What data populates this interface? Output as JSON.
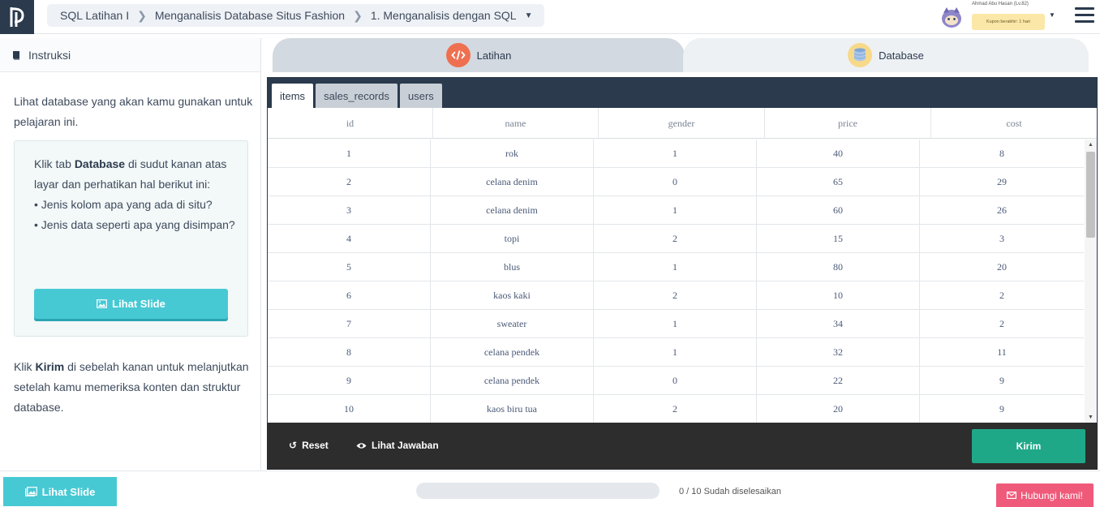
{
  "header": {
    "breadcrumb": [
      "SQL Latihan I",
      "Menganalisis Database Situs Fashion",
      "1. Menganalisis dengan SQL"
    ],
    "user_name": "Ahmad Abu Hasan (Lv.82)",
    "coupon_text": "Kupon berakhir: 1 hari"
  },
  "instructions": {
    "heading": "Instruksi",
    "intro": "Lihat database yang akan kamu gunakan untuk pelajaran ini.",
    "hint_prefix": "Klik tab ",
    "hint_bold": "Database",
    "hint_suffix": " di sudut kanan atas layar dan perhatikan hal berikut ini:",
    "bullet1": "• Jenis kolom apa yang ada di situ?",
    "bullet2": "• Jenis data seperti apa yang disimpan?",
    "slide_button": "Lihat Slide",
    "outro_prefix": "Klik ",
    "outro_bold": "Kirim",
    "outro_suffix": " di sebelah kanan untuk melanjutkan setelah kamu memeriksa konten dan struktur database."
  },
  "main_tabs": {
    "latihan": "Latihan",
    "database": "Database"
  },
  "table_tabs": [
    "items",
    "sales_records",
    "users"
  ],
  "table": {
    "columns": [
      "id",
      "name",
      "gender",
      "price",
      "cost"
    ],
    "rows": [
      [
        "1",
        "rok",
        "1",
        "40",
        "8"
      ],
      [
        "2",
        "celana denim",
        "0",
        "65",
        "29"
      ],
      [
        "3",
        "celana denim",
        "1",
        "60",
        "26"
      ],
      [
        "4",
        "topi",
        "2",
        "15",
        "3"
      ],
      [
        "5",
        "blus",
        "1",
        "80",
        "20"
      ],
      [
        "6",
        "kaos kaki",
        "2",
        "10",
        "2"
      ],
      [
        "7",
        "sweater",
        "1",
        "34",
        "2"
      ],
      [
        "8",
        "celana pendek",
        "1",
        "32",
        "11"
      ],
      [
        "9",
        "celana pendek",
        "0",
        "22",
        "9"
      ],
      [
        "10",
        "kaos biru tua",
        "2",
        "20",
        "9"
      ]
    ]
  },
  "actions": {
    "reset": "Reset",
    "show_answer": "Lihat Jawaban",
    "submit": "Kirim"
  },
  "footer": {
    "slide_button": "Lihat Slide",
    "progress_text": "0 / 10  Sudah diselesaikan",
    "progress_fraction": 0,
    "contact": "Hubungi kami!"
  },
  "colors": {
    "brand_dark": "#2b3a4d",
    "accent_teal": "#47c9d4",
    "submit_green": "#1fa888",
    "contact_pink": "#ef5a7a"
  },
  "icons": [
    "logo-icon",
    "chevron-right-icon",
    "caret-down-icon",
    "avatar-icon",
    "hamburger-icon",
    "book-icon",
    "image-icon",
    "code-icon",
    "database-icon",
    "reset-icon",
    "eye-icon",
    "mail-icon"
  ]
}
